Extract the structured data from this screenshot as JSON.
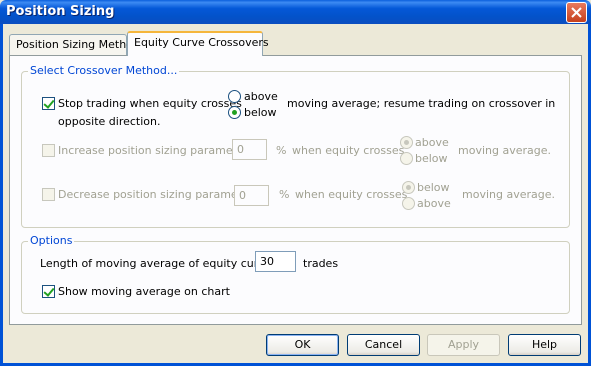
{
  "window": {
    "title": "Position Sizing"
  },
  "tabs": [
    {
      "label": "Position Sizing Method",
      "active": false
    },
    {
      "label": "Equity Curve Crossovers",
      "active": true
    }
  ],
  "crossover_group": {
    "title": "Select Crossover Method...",
    "row1": {
      "checkbox_label_line1": "Stop trading when equity crosses",
      "checkbox_label_line2": "opposite direction.",
      "checked": true,
      "radio_above": "above",
      "radio_below": "below",
      "selected": "below",
      "suffix": "moving average; resume trading on crossover in"
    },
    "row2": {
      "checkbox_label": "Increase position sizing parameter",
      "checked": false,
      "value": "0",
      "percent": "%",
      "when_text": "when equity crosses",
      "radio_first": "above",
      "radio_second": "below",
      "selected": "above",
      "suffix": "moving average."
    },
    "row3": {
      "checkbox_label": "Decrease position sizing parameter",
      "checked": false,
      "value": "0",
      "percent": "%",
      "when_text": "when equity crosses",
      "radio_first": "below",
      "radio_second": "above",
      "selected": "below",
      "suffix": "moving average."
    }
  },
  "options_group": {
    "title": "Options",
    "ma_length_label": "Length of moving average of equity curve:",
    "ma_length_value": "30",
    "ma_length_unit": "trades",
    "show_ma_label": "Show moving average on chart",
    "show_ma_checked": true
  },
  "buttons": {
    "ok": "OK",
    "cancel": "Cancel",
    "apply": "Apply",
    "help": "Help"
  },
  "colors": {
    "titlebar": "#0458d8",
    "group_title": "#0046d5",
    "check": "#21a121"
  }
}
